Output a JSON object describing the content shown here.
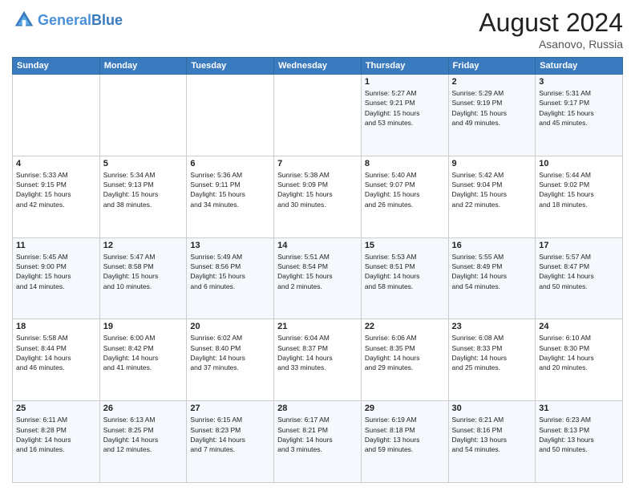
{
  "header": {
    "logo_line1": "General",
    "logo_line2": "Blue",
    "month_title": "August 2024",
    "location": "Asanovo, Russia"
  },
  "weekdays": [
    "Sunday",
    "Monday",
    "Tuesday",
    "Wednesday",
    "Thursday",
    "Friday",
    "Saturday"
  ],
  "weeks": [
    [
      {
        "day": "",
        "info": ""
      },
      {
        "day": "",
        "info": ""
      },
      {
        "day": "",
        "info": ""
      },
      {
        "day": "",
        "info": ""
      },
      {
        "day": "1",
        "info": "Sunrise: 5:27 AM\nSunset: 9:21 PM\nDaylight: 15 hours\nand 53 minutes."
      },
      {
        "day": "2",
        "info": "Sunrise: 5:29 AM\nSunset: 9:19 PM\nDaylight: 15 hours\nand 49 minutes."
      },
      {
        "day": "3",
        "info": "Sunrise: 5:31 AM\nSunset: 9:17 PM\nDaylight: 15 hours\nand 45 minutes."
      }
    ],
    [
      {
        "day": "4",
        "info": "Sunrise: 5:33 AM\nSunset: 9:15 PM\nDaylight: 15 hours\nand 42 minutes."
      },
      {
        "day": "5",
        "info": "Sunrise: 5:34 AM\nSunset: 9:13 PM\nDaylight: 15 hours\nand 38 minutes."
      },
      {
        "day": "6",
        "info": "Sunrise: 5:36 AM\nSunset: 9:11 PM\nDaylight: 15 hours\nand 34 minutes."
      },
      {
        "day": "7",
        "info": "Sunrise: 5:38 AM\nSunset: 9:09 PM\nDaylight: 15 hours\nand 30 minutes."
      },
      {
        "day": "8",
        "info": "Sunrise: 5:40 AM\nSunset: 9:07 PM\nDaylight: 15 hours\nand 26 minutes."
      },
      {
        "day": "9",
        "info": "Sunrise: 5:42 AM\nSunset: 9:04 PM\nDaylight: 15 hours\nand 22 minutes."
      },
      {
        "day": "10",
        "info": "Sunrise: 5:44 AM\nSunset: 9:02 PM\nDaylight: 15 hours\nand 18 minutes."
      }
    ],
    [
      {
        "day": "11",
        "info": "Sunrise: 5:45 AM\nSunset: 9:00 PM\nDaylight: 15 hours\nand 14 minutes."
      },
      {
        "day": "12",
        "info": "Sunrise: 5:47 AM\nSunset: 8:58 PM\nDaylight: 15 hours\nand 10 minutes."
      },
      {
        "day": "13",
        "info": "Sunrise: 5:49 AM\nSunset: 8:56 PM\nDaylight: 15 hours\nand 6 minutes."
      },
      {
        "day": "14",
        "info": "Sunrise: 5:51 AM\nSunset: 8:54 PM\nDaylight: 15 hours\nand 2 minutes."
      },
      {
        "day": "15",
        "info": "Sunrise: 5:53 AM\nSunset: 8:51 PM\nDaylight: 14 hours\nand 58 minutes."
      },
      {
        "day": "16",
        "info": "Sunrise: 5:55 AM\nSunset: 8:49 PM\nDaylight: 14 hours\nand 54 minutes."
      },
      {
        "day": "17",
        "info": "Sunrise: 5:57 AM\nSunset: 8:47 PM\nDaylight: 14 hours\nand 50 minutes."
      }
    ],
    [
      {
        "day": "18",
        "info": "Sunrise: 5:58 AM\nSunset: 8:44 PM\nDaylight: 14 hours\nand 46 minutes."
      },
      {
        "day": "19",
        "info": "Sunrise: 6:00 AM\nSunset: 8:42 PM\nDaylight: 14 hours\nand 41 minutes."
      },
      {
        "day": "20",
        "info": "Sunrise: 6:02 AM\nSunset: 8:40 PM\nDaylight: 14 hours\nand 37 minutes."
      },
      {
        "day": "21",
        "info": "Sunrise: 6:04 AM\nSunset: 8:37 PM\nDaylight: 14 hours\nand 33 minutes."
      },
      {
        "day": "22",
        "info": "Sunrise: 6:06 AM\nSunset: 8:35 PM\nDaylight: 14 hours\nand 29 minutes."
      },
      {
        "day": "23",
        "info": "Sunrise: 6:08 AM\nSunset: 8:33 PM\nDaylight: 14 hours\nand 25 minutes."
      },
      {
        "day": "24",
        "info": "Sunrise: 6:10 AM\nSunset: 8:30 PM\nDaylight: 14 hours\nand 20 minutes."
      }
    ],
    [
      {
        "day": "25",
        "info": "Sunrise: 6:11 AM\nSunset: 8:28 PM\nDaylight: 14 hours\nand 16 minutes."
      },
      {
        "day": "26",
        "info": "Sunrise: 6:13 AM\nSunset: 8:25 PM\nDaylight: 14 hours\nand 12 minutes."
      },
      {
        "day": "27",
        "info": "Sunrise: 6:15 AM\nSunset: 8:23 PM\nDaylight: 14 hours\nand 7 minutes."
      },
      {
        "day": "28",
        "info": "Sunrise: 6:17 AM\nSunset: 8:21 PM\nDaylight: 14 hours\nand 3 minutes."
      },
      {
        "day": "29",
        "info": "Sunrise: 6:19 AM\nSunset: 8:18 PM\nDaylight: 13 hours\nand 59 minutes."
      },
      {
        "day": "30",
        "info": "Sunrise: 6:21 AM\nSunset: 8:16 PM\nDaylight: 13 hours\nand 54 minutes."
      },
      {
        "day": "31",
        "info": "Sunrise: 6:23 AM\nSunset: 8:13 PM\nDaylight: 13 hours\nand 50 minutes."
      }
    ]
  ]
}
